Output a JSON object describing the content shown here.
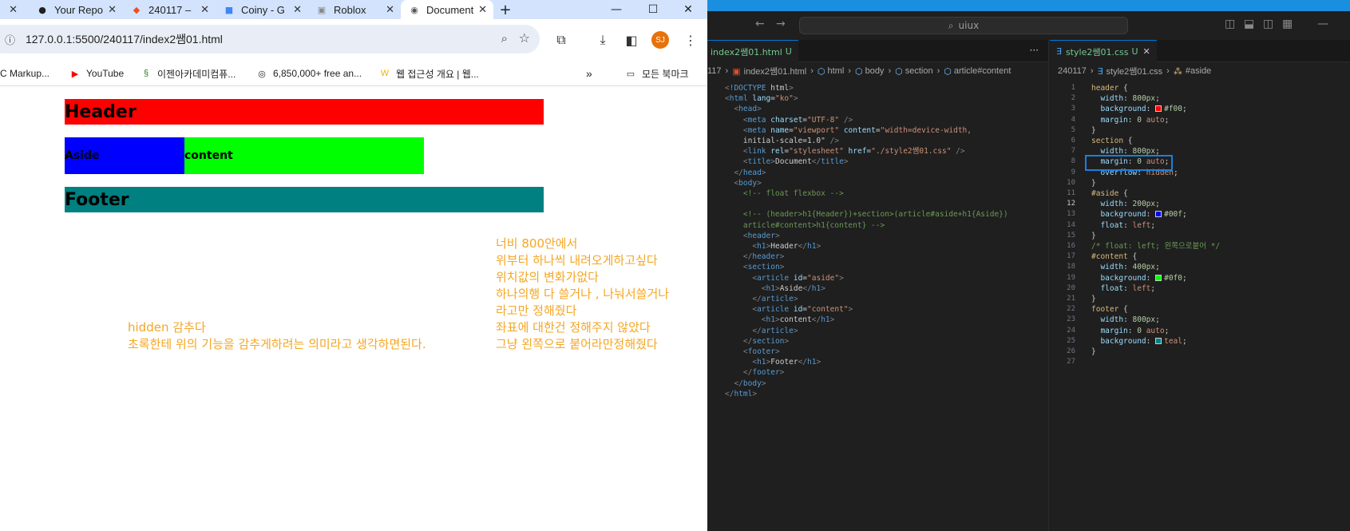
{
  "browser": {
    "tabs": [
      {
        "title": "Your Repo",
        "icon": "github-icon"
      },
      {
        "title": "240117 –",
        "icon": "figma-icon"
      },
      {
        "title": "Coiny - G",
        "icon": "coiny-icon"
      },
      {
        "title": "Roblox",
        "icon": "roblox-icon"
      },
      {
        "title": "Document",
        "icon": "globe-icon",
        "active": true
      }
    ],
    "url": "127.0.0.1:5500/240117/index2쌤01.html",
    "profile_initials": "SJ",
    "bookmarks": [
      {
        "label": "C Markup..."
      },
      {
        "label": "YouTube"
      },
      {
        "label": "이젠아카데미컴퓨..."
      },
      {
        "label": "6,850,000+ free an..."
      },
      {
        "label": "웹 접근성 개요 | 웹..."
      }
    ],
    "all_bookmarks": "모든 북마크"
  },
  "page": {
    "header": "Header",
    "aside": "Aside",
    "content": "content",
    "footer": "Footer",
    "note_right": [
      "너비 800안에서",
      "위부터 하나씩 내려오게하고싶다",
      "위치값의 변화가없다",
      "하나의행 다 쓸거나 , 나눠서쓸거나",
      "라고만 정해줬다",
      "좌표에 대한건 정해주지 않았다",
      "그냥 왼쪽으로 붙어라만정해줬다"
    ],
    "note_left": [
      "hidden 감추다",
      "초록한테 위의 기능을 감추게하려는 의미라고 생각하면된다."
    ],
    "colors": {
      "header": "#ff0000",
      "aside": "#0000ff",
      "content": "#00ff00",
      "footer": "#008080",
      "note": "#f5a623"
    }
  },
  "vscode": {
    "search": "uiux",
    "html_tab": "index2쌤01.html",
    "html_tab_badge": "U",
    "css_tab": "style2쌤01.css",
    "css_tab_badge": "U",
    "html_crumbs": [
      "117",
      "index2쌤01.html",
      "html",
      "body",
      "section",
      "article#content"
    ],
    "css_crumbs": [
      "240117",
      "style2쌤01.css",
      "#aside"
    ],
    "html_lines": [
      "<!DOCTYPE html>",
      "<html lang=\"ko\">",
      "  <head>",
      "    <meta charset=\"UTF-8\" />",
      "    <meta name=\"viewport\" content=\"width=device-width,",
      "    initial-scale=1.0\" />",
      "    <link rel=\"stylesheet\" href=\"./style2쌤01.css\" />",
      "    <title>Document</title>",
      "  </head>",
      "  <body>",
      "    <!-- float flexbox -->",
      "",
      "    <!-- (header>h1{Header})+section>(article#aside+h1{Aside})",
      "    article#content>h1{content} -->",
      "    <header>",
      "      <h1>Header</h1>",
      "    </header>",
      "    <section>",
      "      <article id=\"aside\">",
      "        <h1>Aside</h1>",
      "      </article>",
      "      <article id=\"content\">",
      "        <h1>content</h1>",
      "      </article>",
      "    </section>",
      "    <footer>",
      "      <h1>Footer</h1>",
      "    </footer>",
      "  </body>",
      "</html>"
    ],
    "css_lines": [
      "header {",
      "  width: 800px;",
      "  background: #f00;",
      "  margin: 0 auto;",
      "}",
      "section {",
      "  width: 800px;",
      "  margin: 0 auto;",
      "  overflow: hidden;",
      "}",
      "#aside {",
      "  width: 200px;",
      "  background: #00f;",
      "  float: left;",
      "}",
      "/* float: left; 왼쪽으로붙어 */",
      "#content {",
      "  width: 400px;",
      "  background: #0f0;",
      "  float: left;",
      "}",
      "footer {",
      "  width: 800px;",
      "  margin: 0 auto;",
      "  background: teal;",
      "}",
      ""
    ],
    "current_css_line": 12
  }
}
